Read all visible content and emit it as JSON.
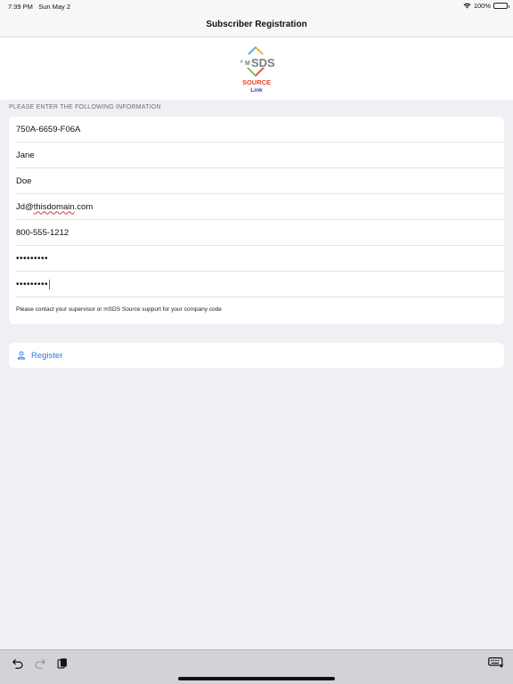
{
  "status": {
    "time": "7:39 PM",
    "date": "Sun May 2",
    "battery": "100%",
    "battery_level": 1.0
  },
  "nav": {
    "title": "Subscriber Registration"
  },
  "logo": {
    "text_m": "M",
    "text_sds": "SDS",
    "text_source": "SOURCE",
    "text_link": "Link"
  },
  "form": {
    "section_header": "PLEASE ENTER THE FOLLOWING INFORMATION",
    "fields": [
      {
        "name": "company-code",
        "value": "750A-6659-F06A"
      },
      {
        "name": "first-name",
        "value": "Jane"
      },
      {
        "name": "last-name",
        "value": "Doe"
      },
      {
        "name": "email",
        "value_prefix": "Jd@",
        "value_underlined": "thisdomain",
        "value_suffix": ".com"
      },
      {
        "name": "phone",
        "value": "800-555-1212"
      },
      {
        "name": "password",
        "value": "•••••••••"
      },
      {
        "name": "confirm-password",
        "value": "•••••••••"
      }
    ],
    "hint": "Please contact your supervisor or mSDS Source support for your company code"
  },
  "register": {
    "label": "Register"
  },
  "colors": {
    "accent": "#2a7ae2",
    "background": "#f0f0f4",
    "logo_source": "#e8452c",
    "logo_link": "#3b3fb6",
    "logo_sds": "#7d7d82"
  }
}
